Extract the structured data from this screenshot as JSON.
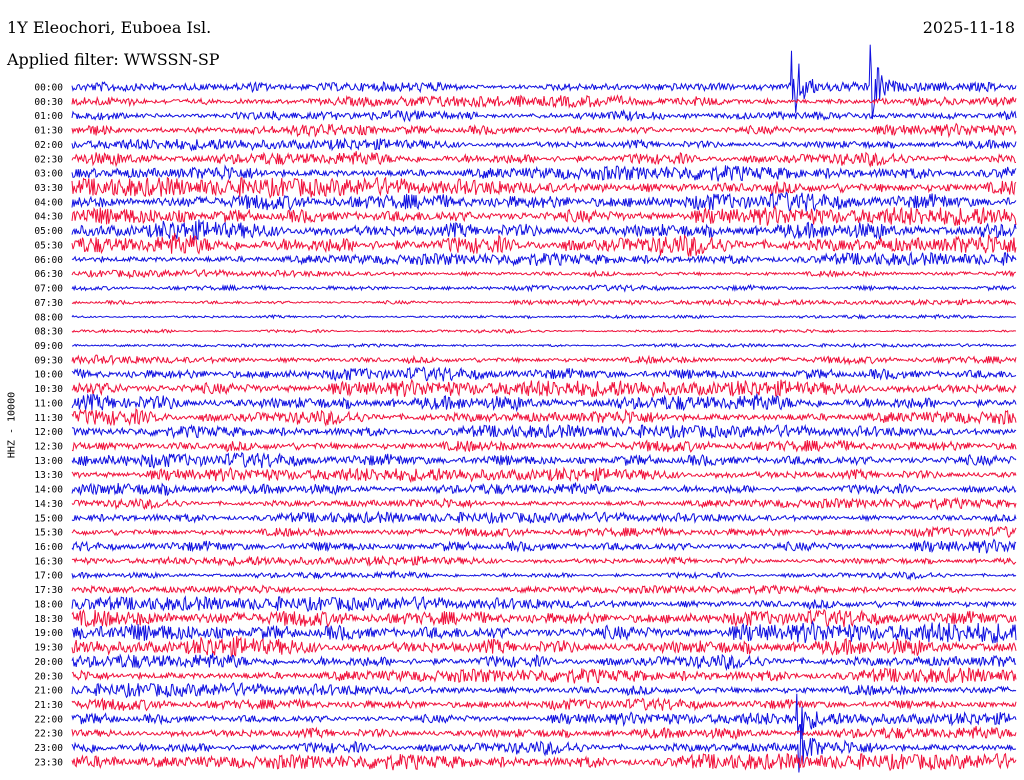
{
  "header": {
    "station": "1Y Eleochori, Euboea Isl.",
    "date": "2025-11-18",
    "filter": "Applied filter: WWSSN-SP"
  },
  "chart_data": {
    "type": "line",
    "ylabel": "HHZ - 10000",
    "row_labels": [
      "00:00",
      "00:30",
      "01:00",
      "01:30",
      "02:00",
      "02:30",
      "03:00",
      "03:30",
      "04:00",
      "04:30",
      "05:00",
      "05:30",
      "06:00",
      "06:30",
      "07:00",
      "07:30",
      "08:00",
      "08:30",
      "09:00",
      "09:30",
      "10:00",
      "10:30",
      "11:00",
      "11:30",
      "12:00",
      "12:30",
      "13:00",
      "13:30",
      "14:00",
      "14:30",
      "15:00",
      "15:30",
      "16:00",
      "16:30",
      "17:00",
      "17:30",
      "18:00",
      "18:30",
      "19:00",
      "19:30",
      "20:00",
      "20:30",
      "21:00",
      "21:30",
      "22:00",
      "22:30",
      "23:00",
      "23:30"
    ],
    "series_colors": [
      "#1010e0",
      "#f0103a"
    ],
    "relative_amplitude": [
      0.45,
      0.55,
      0.5,
      0.6,
      0.55,
      0.7,
      0.75,
      0.9,
      0.95,
      0.9,
      1.0,
      1.1,
      0.6,
      0.35,
      0.3,
      0.25,
      0.2,
      0.18,
      0.15,
      0.45,
      0.7,
      0.8,
      0.85,
      0.75,
      0.6,
      0.7,
      0.75,
      0.65,
      0.6,
      0.5,
      0.5,
      0.55,
      0.65,
      0.45,
      0.35,
      0.4,
      0.65,
      0.85,
      1.0,
      1.0,
      0.75,
      0.7,
      0.65,
      0.6,
      0.6,
      0.65,
      0.7,
      0.75
    ],
    "events": [
      {
        "row": 0,
        "x_fraction": 0.765,
        "amplitude": 5.0
      },
      {
        "row": 0,
        "x_fraction": 0.848,
        "amplitude": 5.5
      },
      {
        "row": 44,
        "x_fraction": 0.77,
        "amplitude": 3.0
      },
      {
        "row": 46,
        "x_fraction": 0.772,
        "amplitude": 3.5
      }
    ]
  }
}
